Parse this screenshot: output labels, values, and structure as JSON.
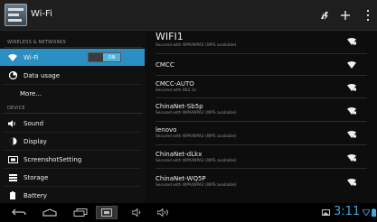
{
  "actionbar": {
    "title": "Wi-Fi",
    "icons": [
      "settings-app-icon",
      "wps-icon",
      "add-network-icon",
      "overflow-menu-icon"
    ]
  },
  "sidebar": {
    "section_wireless": "WIRELESS & NETWORKS",
    "section_device": "DEVICE",
    "items": [
      {
        "label": "Wi-Fi",
        "icon": "wifi-icon",
        "selected": true,
        "toggle": "ON"
      },
      {
        "label": "Data usage",
        "icon": "data-usage-icon"
      },
      {
        "label": "More...",
        "icon": ""
      },
      {
        "label": "Sound",
        "icon": "sound-icon"
      },
      {
        "label": "Display",
        "icon": "display-icon"
      },
      {
        "label": "ScreenshotSetting",
        "icon": "screenshot-icon"
      },
      {
        "label": "Storage",
        "icon": "storage-icon"
      },
      {
        "label": "Battery",
        "icon": "battery-icon"
      }
    ]
  },
  "networks": [
    {
      "name": "WIFI1",
      "status": "Secured with WPA/WPA2 (WPS available)",
      "icon": "wifi-signal-locked-icon"
    },
    {
      "name": "CMCC",
      "status": "",
      "icon": "wifi-signal-icon"
    },
    {
      "name": "CMCC-AUTO",
      "status": "Secured with 802.1x",
      "icon": "wifi-signal-locked-icon"
    },
    {
      "name": "ChinaNet-Sb5p",
      "status": "Secured with WPA/WPA2 (WPS available)",
      "icon": "wifi-signal-locked-icon"
    },
    {
      "name": "lenovo",
      "status": "Secured with WPA/WPA2 (WPS available)",
      "icon": "wifi-signal-locked-icon"
    },
    {
      "name": "ChinaNet-dLkx",
      "status": "Secured with WPA/WPA2 (WPS available)",
      "icon": "wifi-signal-locked-icon"
    },
    {
      "name": "ChinaNet-WQ5P",
      "status": "Secured with WPA/WPA2 (WPS available)",
      "icon": "wifi-signal-locked-icon"
    }
  ],
  "systembar": {
    "buttons": [
      "back-icon",
      "home-icon",
      "recent-apps-icon",
      "screenshot-icon",
      "volume-down-icon",
      "volume-up-icon"
    ],
    "time": "3:11",
    "status_icons": [
      "gallery-notification-icon",
      "wifi-status-icon",
      "battery-status-icon"
    ]
  },
  "colors": {
    "accent": "#2c8fc3",
    "clock": "#3ea9e0"
  }
}
